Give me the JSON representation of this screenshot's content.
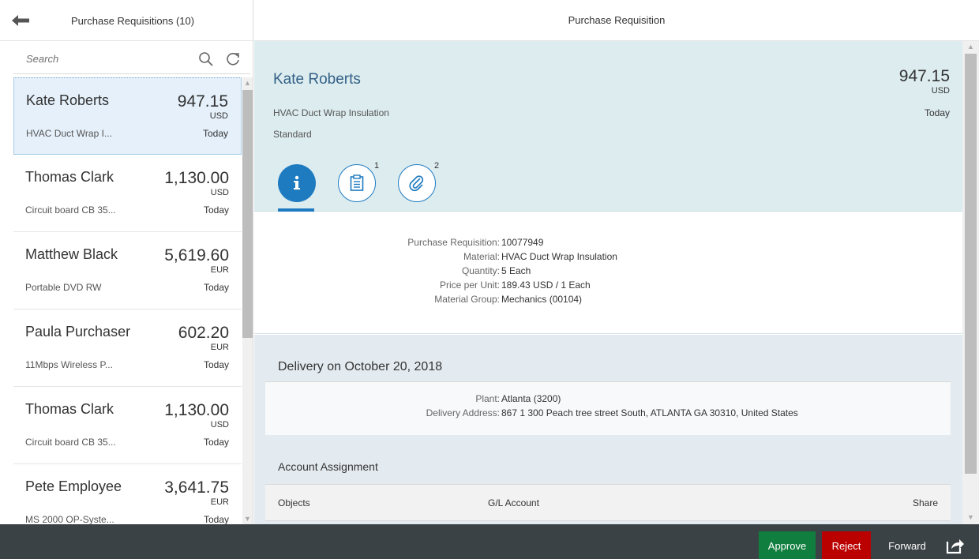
{
  "master": {
    "title": "Purchase Requisitions (10)",
    "search_placeholder": "Search",
    "items": [
      {
        "name": "Kate Roberts",
        "amount": "947.15",
        "currency": "USD",
        "description": "HVAC Duct Wrap I...",
        "date": "Today",
        "selected": true
      },
      {
        "name": "Thomas Clark",
        "amount": "1,130.00",
        "currency": "USD",
        "description": "Circuit board CB 35...",
        "date": "Today",
        "selected": false
      },
      {
        "name": "Matthew Black",
        "amount": "5,619.60",
        "currency": "EUR",
        "description": "Portable DVD RW",
        "date": "Today",
        "selected": false
      },
      {
        "name": "Paula Purchaser",
        "amount": "602.20",
        "currency": "EUR",
        "description": "11Mbps Wireless P...",
        "date": "Today",
        "selected": false
      },
      {
        "name": "Thomas Clark",
        "amount": "1,130.00",
        "currency": "USD",
        "description": "Circuit board CB 35...",
        "date": "Today",
        "selected": false
      },
      {
        "name": "Pete Employee",
        "amount": "3,641.75",
        "currency": "EUR",
        "description": "MS 2000 OP-Syste...",
        "date": "Today",
        "selected": false
      }
    ]
  },
  "detail": {
    "title": "Purchase Requisition",
    "header": {
      "name": "Kate Roberts",
      "amount": "947.15",
      "currency": "USD",
      "attribute1": "HVAC Duct Wrap Insulation",
      "attribute2": "Standard",
      "status": "Today"
    },
    "tabs": [
      {
        "icon": "info-icon",
        "count": ""
      },
      {
        "icon": "notes-icon",
        "count": "1"
      },
      {
        "icon": "attachment-icon",
        "count": "2"
      }
    ],
    "info": [
      {
        "label": "Purchase Requisition:",
        "value": "10077949"
      },
      {
        "label": "Material:",
        "value": "HVAC Duct Wrap Insulation"
      },
      {
        "label": "Quantity:",
        "value": "5 Each"
      },
      {
        "label": "Price per Unit:",
        "value": "189.43 USD / 1 Each"
      },
      {
        "label": "Material Group:",
        "value": "Mechanics (00104)"
      }
    ],
    "delivery": {
      "title": "Delivery on October 20, 2018",
      "fields": [
        {
          "label": "Plant:",
          "value": "Atlanta (3200)"
        },
        {
          "label": "Delivery Address:",
          "value": "867 1 300 Peach tree street South, ATLANTA GA 30310, United States"
        }
      ]
    },
    "account": {
      "title": "Account Assignment",
      "columns": [
        "Objects",
        "G/L Account",
        "Share"
      ]
    }
  },
  "footer": {
    "approve": "Approve",
    "reject": "Reject",
    "forward": "Forward"
  },
  "colors": {
    "accent": "#1f7bc0",
    "approve": "#107e3e",
    "reject": "#bb0000",
    "footer": "#3b4245"
  }
}
